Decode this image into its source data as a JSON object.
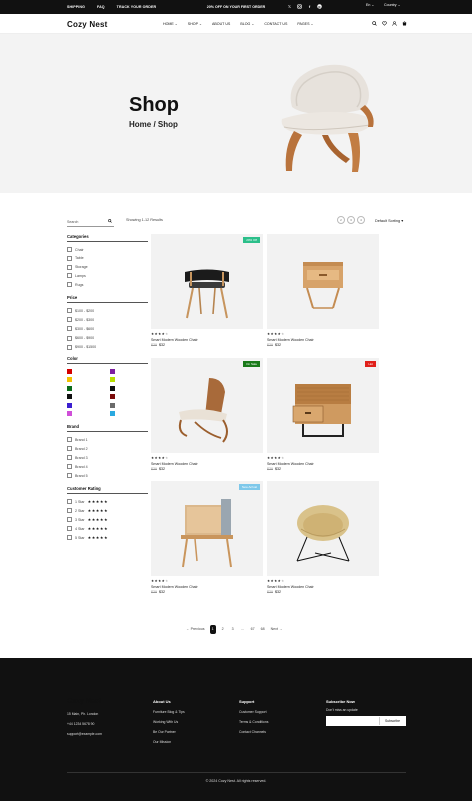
{
  "topbar": {
    "links": [
      "SHIPPING",
      "FAQ",
      "TRACK YOUR ORDER"
    ],
    "promo": "20% OFF ON YOUR FIRST ORDER",
    "social_icons": [
      "x-icon",
      "instagram-icon",
      "facebook-icon",
      "pinterest-icon"
    ],
    "language": "En",
    "country": "Country"
  },
  "header": {
    "logo": "Cozy Nest",
    "nav": [
      "HOME",
      "SHOP",
      "ABOUT US",
      "BLOG",
      "CONTACT US",
      "PAGES"
    ],
    "nav_dropdown": [
      true,
      true,
      false,
      true,
      false,
      true
    ],
    "icons": [
      "search-icon",
      "heart-icon",
      "user-icon",
      "cart-icon"
    ]
  },
  "hero": {
    "title": "Shop",
    "breadcrumb": "Home / Shop"
  },
  "sidebar": {
    "search_placeholder": "Search",
    "categories_title": "Categories",
    "categories": [
      "Chair",
      "Table",
      "Storage",
      "Lamps",
      "Rugs"
    ],
    "price_title": "Price",
    "prices": [
      "$100 - $200",
      "$200 - $300",
      "$300 - $600",
      "$600 - $900",
      "$900 - $1500"
    ],
    "color_title": "Color",
    "colors_left": [
      "#d40000",
      "#f2c200",
      "#0b6b1a",
      "#101010",
      "#3b1fd0",
      "#cf4fd8"
    ],
    "colors_right": [
      "#7d1fa0",
      "#b7e000",
      "#101010",
      "#7a0a0a",
      "#6b6b6b",
      "#2aa9e0"
    ],
    "brand_title": "Brand",
    "brands": [
      "Brand 1",
      "Brand 2",
      "Brand 3",
      "Brand 4",
      "Brand 5"
    ],
    "rating_title": "Customer Rating",
    "ratings": [
      "1 Star",
      "2 Star",
      "3 Star",
      "4 Star",
      "5 Star"
    ]
  },
  "toolbar": {
    "results": "Showing 1-12 Results",
    "view_buttons": [
      "2",
      "3",
      "4"
    ],
    "sort": "Default Sorting"
  },
  "products": [
    {
      "badge": "20% Off",
      "badge_color": "#2bbf8a",
      "rating": 4,
      "name": "Smart Modern Wooden Chair",
      "old_price": "$39",
      "price": "$32"
    },
    {
      "badge": "",
      "badge_color": "",
      "rating": 4,
      "name": "Smart Modern Wooden Chair",
      "old_price": "$39",
      "price": "$32"
    },
    {
      "badge": "On Sale",
      "badge_color": "#1a7a1a",
      "rating": 4,
      "name": "Smart Modern Wooden Chair",
      "old_price": "$39",
      "price": "$32"
    },
    {
      "badge": "Hot",
      "badge_color": "#e0201a",
      "rating": 4,
      "name": "Smart Modern Wooden Chair",
      "old_price": "$39",
      "price": "$32"
    },
    {
      "badge": "",
      "badge_color": "",
      "rating": 4,
      "name": "Smart Modern Wooden Chair",
      "old_price": "$39",
      "price": "$32"
    },
    {
      "badge": "",
      "badge_color": "",
      "rating": 4,
      "name": "Smart Modern Wooden Chair",
      "old_price": "$39",
      "price": "$32"
    },
    {
      "badge": "New Arrival",
      "badge_color": "#7ec8ea",
      "rating": 4,
      "name": "Smart Modern Wooden Chair",
      "old_price": "$39",
      "price": "$32"
    },
    {
      "badge": "",
      "badge_color": "",
      "rating": 4,
      "name": "Smart Modern Wooden Chair",
      "old_price": "$39",
      "price": "$32"
    }
  ],
  "pagination": {
    "prev": "← Previous",
    "pages": [
      "1",
      "2",
      "3",
      "...",
      "67",
      "68"
    ],
    "active": "1",
    "next": "Next →"
  },
  "footer": {
    "logo": "Cozy Nest",
    "address": "15 Main, Ph. London",
    "phone": "+44 1234 5678 90",
    "email": "support@example.com",
    "about_title": "About Us",
    "about_links": [
      "Furniture Blog & Tips",
      "Working With Us",
      "Be Our Partner",
      "Our Mission"
    ],
    "support_title": "Support",
    "support_links": [
      "Customer Support",
      "Terms & Conditions",
      "Contact Channels"
    ],
    "subscribe_title": "Subscribe Now",
    "subscribe_text": "Don't miss an update",
    "subscribe_button": "Subscribe",
    "copyright": "© 2024 Cozy Nest. All rights reserved."
  }
}
